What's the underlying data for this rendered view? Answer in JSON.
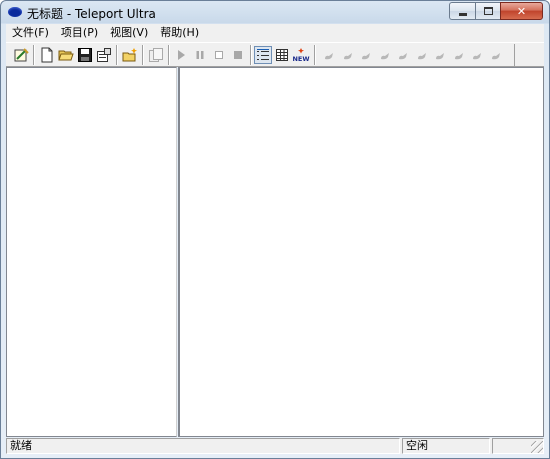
{
  "window": {
    "title": "无标题 - Teleport Ultra",
    "app_icon": "teleport-ellipse-icon",
    "caption_buttons": [
      "minimize-icon",
      "maximize-icon",
      "close-icon"
    ],
    "close_glyph": "✕"
  },
  "menu": {
    "items": [
      {
        "label": "文件(F)"
      },
      {
        "label": "项目(P)"
      },
      {
        "label": "视图(V)"
      },
      {
        "label": "帮助(H)"
      }
    ]
  },
  "toolbar": {
    "new_label": "NEW",
    "icons": [
      "wizard-icon",
      "new-file-icon",
      "open-folder-icon",
      "save-icon",
      "properties-icon",
      "new-project-icon",
      "copy-project-icon",
      "play-icon",
      "pause-icon",
      "stop-outline-icon",
      "stop-icon",
      "list-view-icon",
      "grid-view-icon",
      "new-items-icon",
      "link-icon"
    ],
    "link_icon_count": 10
  },
  "status": {
    "left_text": "就绪",
    "right_text": "空闲"
  },
  "colors": {
    "title_gradient_top": "#dbe7f3",
    "close_button": "#c0432c",
    "chrome": "#f0f0f0",
    "app_icon": "#0a2a9c"
  }
}
